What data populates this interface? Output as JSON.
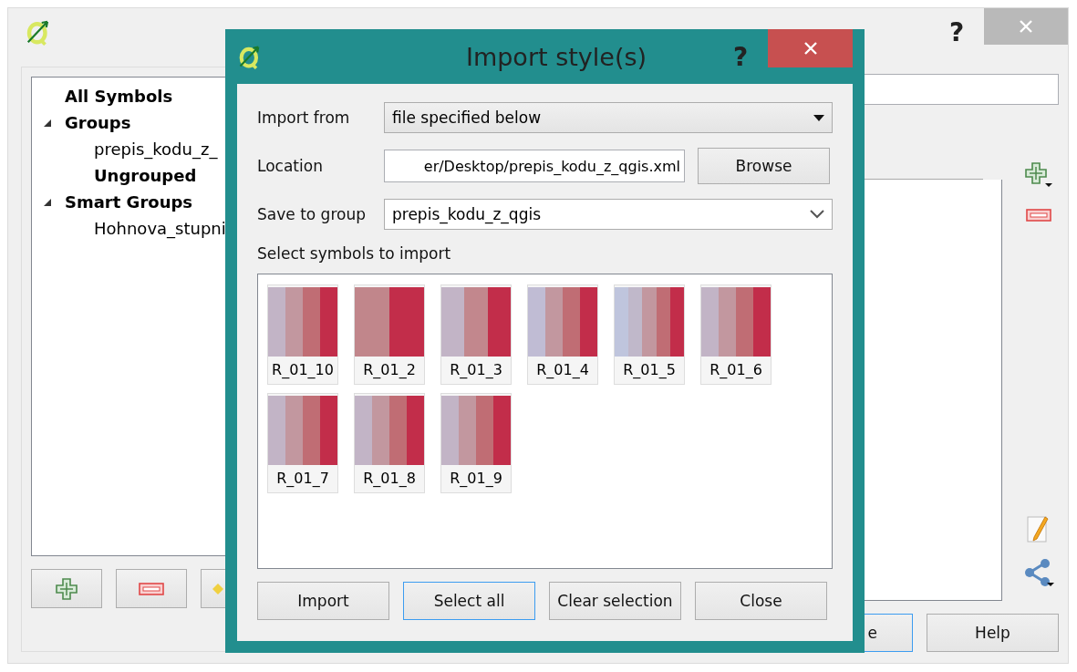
{
  "main_window": {
    "help": "?",
    "tree": [
      {
        "label": "All Symbols",
        "bold": true
      },
      {
        "label": "Groups",
        "bold": true,
        "expanded": true,
        "children": [
          {
            "label": "prepis_kodu_z_",
            "bold": false
          },
          {
            "label": "Ungrouped",
            "bold": true
          }
        ]
      },
      {
        "label": "Smart Groups",
        "bold": true,
        "expanded": true,
        "children": [
          {
            "label": "Hohnova_stupni",
            "bold": false
          }
        ]
      }
    ],
    "buttons": [
      {
        "label": "e",
        "focused": true
      },
      {
        "label": "Help",
        "focused": false
      }
    ]
  },
  "dialog": {
    "title": "Import style(s)",
    "help": "?",
    "import_from": {
      "label": "Import from",
      "value": "file specified below"
    },
    "location": {
      "label": "Location",
      "value": "er/Desktop/prepis_kodu_z_qgis.xml",
      "button": "Browse"
    },
    "save_to_group": {
      "label": "Save to group",
      "value": "prepis_kodu_z_qgis"
    },
    "symbols_label": "Select symbols to import",
    "symbols": [
      {
        "name": "R_01_10",
        "kind": "four"
      },
      {
        "name": "R_01_2",
        "kind": "two"
      },
      {
        "name": "R_01_3",
        "kind": "three"
      },
      {
        "name": "R_01_4",
        "kind": "fourblue"
      },
      {
        "name": "R_01_5",
        "kind": "five"
      },
      {
        "name": "R_01_6",
        "kind": "four"
      },
      {
        "name": "R_01_7",
        "kind": "four"
      },
      {
        "name": "R_01_8",
        "kind": "four"
      },
      {
        "name": "R_01_9",
        "kind": "four"
      }
    ],
    "buttons": [
      {
        "label": "Import",
        "focused": false
      },
      {
        "label": "Select all",
        "focused": true
      },
      {
        "label": "Clear selection",
        "focused": false
      },
      {
        "label": "Close",
        "focused": false
      }
    ]
  }
}
